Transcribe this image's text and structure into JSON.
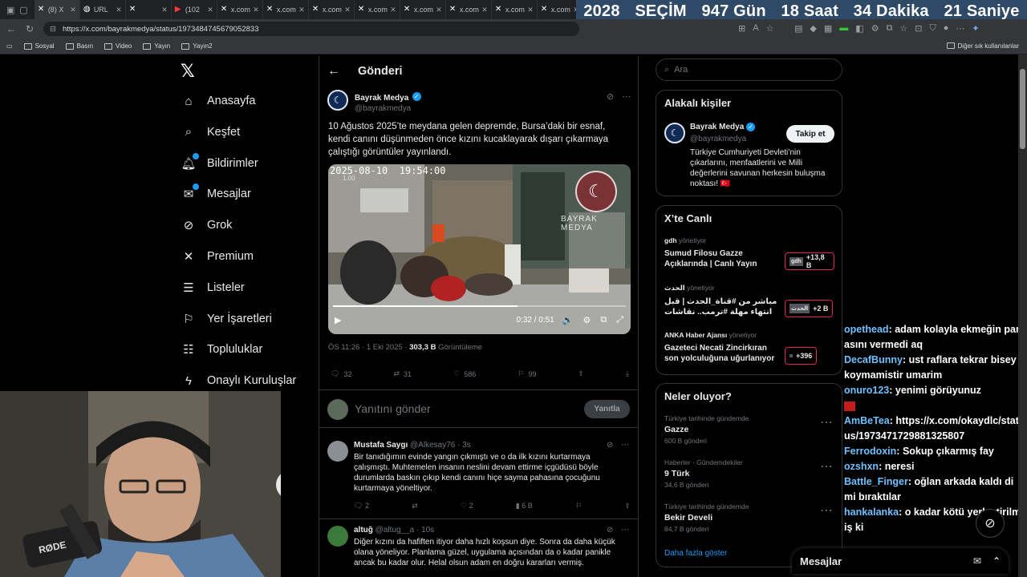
{
  "browser": {
    "tabs": [
      {
        "label": "(8) X",
        "icon": "x-icon"
      },
      {
        "label": "URL",
        "icon": "globe-icon"
      },
      {
        "label": "",
        "icon": "x-icon"
      },
      {
        "label": "(102",
        "icon": "youtube-icon"
      },
      {
        "label": "x.com",
        "icon": "x-icon"
      },
      {
        "label": "x.com",
        "icon": "x-icon"
      },
      {
        "label": "x.com",
        "icon": "x-icon"
      },
      {
        "label": "x.com",
        "icon": "x-icon"
      },
      {
        "label": "x.com",
        "icon": "x-icon"
      },
      {
        "label": "x.com",
        "icon": "x-icon"
      },
      {
        "label": "x.com",
        "icon": "x-icon"
      },
      {
        "label": "x.com",
        "icon": "x-icon"
      }
    ],
    "url": "https://x.com/bayrakmedya/status/1973484745679052833",
    "bookmarks": [
      "Sosyal",
      "Basın",
      "Video",
      "Yayın",
      "Yayın2"
    ],
    "bookmarks_other": "Diğer sık kullanılanlar"
  },
  "banner": {
    "year": "2028",
    "label": "SEÇİM",
    "days": "947 Gün",
    "hours": "18 Saat",
    "minutes": "34 Dakika",
    "seconds": "21 Saniye"
  },
  "sidebar": {
    "items": [
      {
        "label": "Anasayfa",
        "icon": "home-icon"
      },
      {
        "label": "Keşfet",
        "icon": "search-icon"
      },
      {
        "label": "Bildirimler",
        "icon": "bell-icon"
      },
      {
        "label": "Mesajlar",
        "icon": "mail-icon"
      },
      {
        "label": "Grok",
        "icon": "grok-icon"
      },
      {
        "label": "Premium",
        "icon": "x-icon"
      },
      {
        "label": "Listeler",
        "icon": "list-icon"
      },
      {
        "label": "Yer İşaretleri",
        "icon": "bookmark-icon"
      },
      {
        "label": "Topluluklar",
        "icon": "people-icon"
      },
      {
        "label": "Onaylı Kuruluşlar",
        "icon": "lightning-icon"
      }
    ]
  },
  "main": {
    "title": "Gönderi",
    "post": {
      "name": "Bayrak Medya",
      "handle": "@bayrakmedya",
      "text": "10 Ağustos 2025’te meydana gelen depremde, Bursa’daki bir esnaf, kendi canını düşünmeden önce kızını kucaklayarak dışarı çıkarmaya çalıştığı görüntüler yayınlandı.",
      "video": {
        "timestamp": "2025-08-10  19:54:00",
        "speed": "1.00",
        "watermark": "BAYRAK MEDYA",
        "time": "0:32 / 0:51",
        "progress": 0.63
      },
      "meta_time": "ÖS 11:26 · 1 Eki 2025 · ",
      "meta_views": "303,3 B",
      "meta_views_label": " Görüntüleme",
      "stats": {
        "replies": "32",
        "reposts": "31",
        "likes": "586",
        "bookmarks": "99"
      }
    },
    "reply_placeholder": "Yanıtını gönder",
    "reply_button": "Yanıtla",
    "replies": [
      {
        "name": "Mustafa Saygı",
        "handle": "@Alkesay76 · 3s",
        "text": "Bir tanıdığımın evinde yangın çıkmıştı ve o da ilk kızını kurtarmaya çalışmıştı. Muhtemelen insanın neslini devam ettirme içgüdüsü böyle durumlarda baskın çıkıp kendi canını hiçe sayma pahasına çocuğunu kurtarmaya yöneltiyor.",
        "replies": "2",
        "likes": "2",
        "views": "6 B"
      },
      {
        "name": "altuğ",
        "handle": "@altug__a · 10s",
        "text": "Diğer kızını da hafiften itiyor daha hızlı koşsun diye. Sonra da daha küçük olana yöneliyor. Planlama güzel, uygulama açısından da o kadar panikle ancak bu kadar olur. Helal olsun adam en doğru kararları vermiş."
      }
    ]
  },
  "right": {
    "search_placeholder": "Ara",
    "related": {
      "title": "Alakalı kişiler",
      "name": "Bayrak Medya",
      "handle": "@bayrakmedya",
      "follow": "Takip et",
      "bio": "Türkiye Cumhuriyeti Devleti’nin çıkarlarını, menfaatlerini ve Milli değerlerini savunan herkesin buluşma noktası! 🇹🇷"
    },
    "live": {
      "title": "X’te Canlı",
      "items": [
        {
          "host": "gdh",
          "role": "yönetiyor",
          "title": "Sumud Filosu Gazze Açıklarında | Canlı Yayın",
          "count": "+13,8 B",
          "badge": "gdh"
        },
        {
          "host": "الحدث",
          "role": "yönetiyor",
          "title": "مباشر من #قناة_الحدث | قبل انتهاء مهلة #ترمب.. نقاشات #حماس ...",
          "count": "+2 B",
          "badge": "الحدث"
        },
        {
          "host": "ANKA Haber Ajansı",
          "role": "yönetiyor",
          "title": "Gazeteci Necati Zincirkıran son yolculuğuna uğurlanıyor ...",
          "count": "+396",
          "badge": ""
        }
      ]
    },
    "trends": {
      "title": "Neler oluyor?",
      "items": [
        {
          "context": "Türkiye tarihinde gündemde",
          "name": "Gazze",
          "count": "600 B gönderi"
        },
        {
          "context": "Haberler · Gündemdekiler",
          "name": "9 Türk",
          "count": "34,6 B gönderi"
        },
        {
          "context": "Türkiye tarihinde gündemde",
          "name": "Bekir Develi",
          "count": "84,7 B gönderi"
        }
      ],
      "more": "Daha fazla göster"
    }
  },
  "chat": [
    {
      "user": "opethead",
      "text": "adam kolayla ekmeğin parasını vermedi aq"
    },
    {
      "user": "DecafBunny",
      "text": "ust raflara tekrar bisey koymamistir umarim"
    },
    {
      "user": "onuro123",
      "text": "yenimi görüyunuz"
    },
    {
      "user": "",
      "text": ""
    },
    {
      "user": "AmBeTea",
      "text": "https://x.com/okaydlc/status/1973471729881325807"
    },
    {
      "user": "Ferrodoxin",
      "text": "Sokup çıkarmış fay"
    },
    {
      "user": "ozshxn",
      "text": "neresi"
    },
    {
      "user": "Battle_Finger",
      "text": "oğlan arkada kaldı dimi bıraktılar"
    },
    {
      "user": "hankalanka",
      "text": "o kadar kötü yerleştirilmiş ki"
    }
  ],
  "messages_bar": "Mesajlar",
  "webcam": {
    "mic_brand": "RØDE"
  },
  "colors": {
    "banner": "#2f4a66",
    "accent": "#1d9bf0",
    "chat_name": "#6ec1ff"
  }
}
